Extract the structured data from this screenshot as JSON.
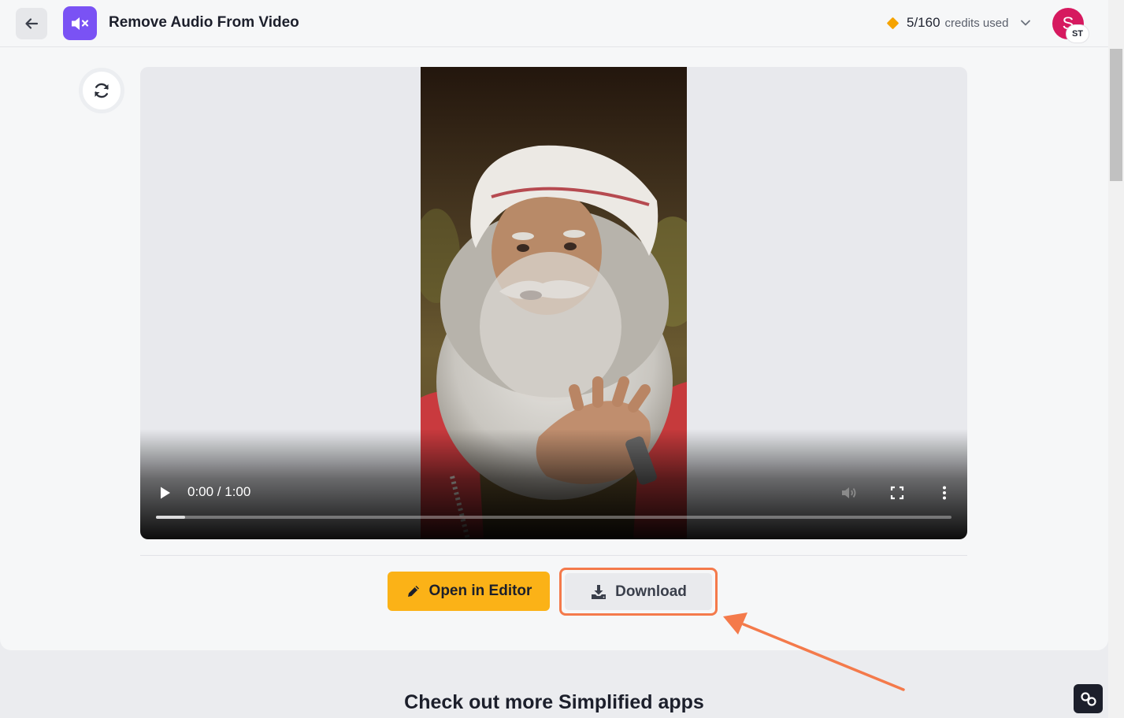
{
  "header": {
    "back_icon": "arrow-left-icon",
    "app_icon": "muted-speaker-icon",
    "app_title": "Remove Audio From Video",
    "credits_count": "5/160",
    "credits_label": "credits used",
    "avatar_letter": "S",
    "avatar_badge": "ST",
    "accent_color": "#7a52f4",
    "avatar_color": "#d6195f",
    "credits_icon_color": "#f5a300"
  },
  "player": {
    "time": "0:00 / 1:00",
    "progress_fraction": 0.037,
    "controls": [
      "play-icon",
      "volume-icon",
      "fullscreen-icon",
      "more-vert-icon"
    ]
  },
  "actions": {
    "open_editor_label": "Open in Editor",
    "download_label": "Download",
    "editor_color": "#fbb217",
    "highlight_color": "#f47a4b"
  },
  "more_apps": {
    "heading": "Check out more Simplified apps"
  }
}
